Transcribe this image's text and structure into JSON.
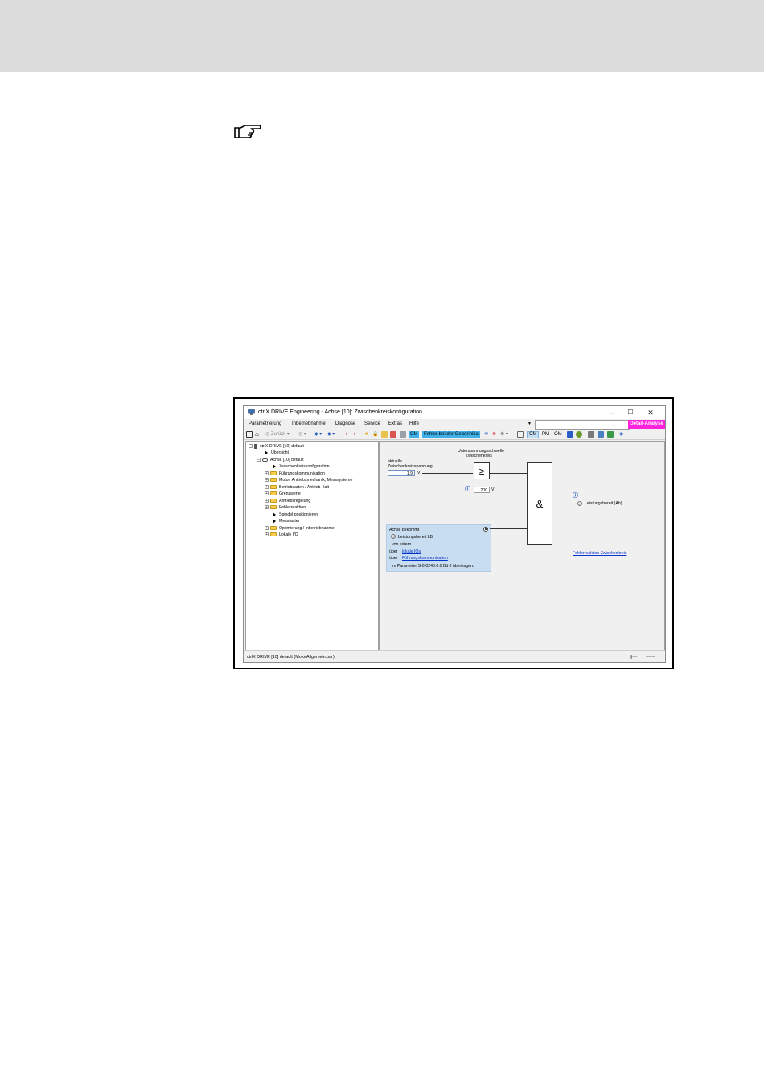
{
  "window": {
    "title": "ctrlX DRIVE Engineering - Achse [10]: Zwischenkreiskonfiguration",
    "controls": [
      "–",
      "☐",
      "✕"
    ]
  },
  "menu": {
    "items": [
      "Parametrierung",
      "Inbetriebnahme",
      "Diagnose",
      "Service",
      "Extras",
      "Hilfe"
    ],
    "search_placeholder": "",
    "detail_button": "Detail-Analyse"
  },
  "toolbar": {
    "back_label": "Zurück",
    "cm_label": "CM",
    "error_text": "Fehler bei der Geberinitia",
    "mode_cm": "CM",
    "mode_pm": "PM",
    "mode_om": "OM"
  },
  "tree": {
    "items": [
      "ctrlX DRIVE [10] default",
      "Übersicht",
      "Achse [10] default",
      "Zwischenkreiskonfiguration",
      "Führungskommunikation",
      "Motor, Antriebsmechanik, Messsysteme",
      "Betriebsarten / Antrieb Halt",
      "Grenzwerte",
      "Antriebsregelung",
      "Fehlerreaktion",
      "Spindel positionieren",
      "Messtaster",
      "Optimierung / Inbetriebnahme",
      "Lokale I/O"
    ]
  },
  "diagram": {
    "threshold_label_1": "Unterspannungsschwelle",
    "threshold_label_2": "Zwischenkreis",
    "voltage_label_1": "aktuelle",
    "voltage_label_2": "Zwischenkreisspannung",
    "voltage_value": "1.9",
    "voltage_unit": "V",
    "threshold_value": "200",
    "threshold_unit": "V",
    "compare_symbol": "≥",
    "and_symbol": "&",
    "output_label": "Leistungsbereit (Ab)",
    "panel_title": "Achse bekommt",
    "panel_lb": "Leistungsbereit LB",
    "panel_extern": "von extern",
    "panel_via_1": "über",
    "panel_link_1": "lokale IOs",
    "panel_via_2": "über",
    "panel_link_2": "Führungskommunikation",
    "panel_param": "im Parameter S-0-0240.0.0 Bit 0 übertragen.",
    "error_link": "Fehlerreaktion Zwischenkreis"
  },
  "status": {
    "text": "ctrlX DRIVE [10] default (MotorAllgemein.par)"
  }
}
